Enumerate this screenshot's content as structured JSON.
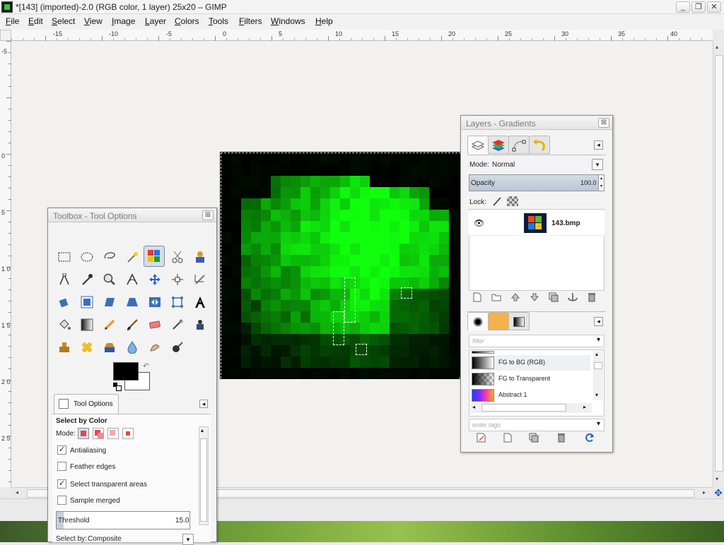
{
  "window": {
    "title": "*[143] (imported)-2.0 (RGB color, 1 layer) 25x20 – GIMP",
    "minimize": "_",
    "maximize": "❐",
    "close": "✕"
  },
  "menu": [
    "File",
    "Edit",
    "Select",
    "View",
    "Image",
    "Layer",
    "Colors",
    "Tools",
    "Filters",
    "Windows",
    "Help"
  ],
  "hruler": [
    "-15",
    "-10",
    "-5",
    "0",
    "5",
    "10",
    "15",
    "20",
    "25",
    "30",
    "35",
    "40"
  ],
  "vruler": [
    "-5",
    "0",
    "5",
    "1 0",
    "1 5",
    "2 0",
    "2 5"
  ],
  "toolbox": {
    "title": "Toolbox - Tool Options",
    "close": "⊠",
    "tools": [
      "rect-select",
      "ellipse-select",
      "free-select",
      "fuzzy-select",
      "select-by-color",
      "scissors-select",
      "foreground-select",
      "paths",
      "color-picker",
      "zoom",
      "measure",
      "move",
      "align",
      "crop",
      "rotate",
      "scale",
      "shear",
      "perspective",
      "flip",
      "cage",
      "text",
      "bucket-fill",
      "blend",
      "pencil",
      "paintbrush",
      "eraser",
      "airbrush",
      "ink",
      "clone",
      "heal",
      "perspective-clone",
      "blur",
      "smudge",
      "dodge-burn"
    ],
    "tool_options_tab": "Tool Options",
    "tool_name": "Select by Color",
    "mode_label": "Mode:",
    "antialiasing": "Antialiasing",
    "feather": "Feather edges",
    "select_transparent": "Select transparent areas",
    "sample_merged": "Sample merged",
    "threshold_label": "Threshold",
    "threshold_value": "15.0",
    "select_by_label": "Select by:",
    "select_by_value": "Composite",
    "check": "✓"
  },
  "layers": {
    "title": "Layers - Gradients",
    "close": "⊠",
    "mode_label": "Mode:",
    "mode_value": "Normal",
    "opacity_label": "Opacity",
    "opacity_value": "100.0",
    "lock_label": "Lock:",
    "layer_name": "143.bmp",
    "filter_placeholder": "filter",
    "tags_placeholder": "enter tags",
    "gradients": [
      {
        "name": "FG to BG (RGB)",
        "colors": "linear-gradient(90deg, #000, #fff)"
      },
      {
        "name": "FG to Transparent",
        "colors": "linear-gradient(90deg, #000, rgba(0,0,0,0)), repeating-conic-gradient(#bbb 0 25%, #fff 0 50%) 0 0/8px 8px"
      },
      {
        "name": "Abstract 1",
        "colors": "linear-gradient(90deg, #1f3cff, #7a2cff, #ff3ca0, #ffb01f)"
      }
    ]
  },
  "glyphs": {
    "arrow_left": "◂",
    "arrow_right": "▸",
    "arrow_up": "▴",
    "arrow_down": "▾",
    "eye": "👁",
    "nav": "✥",
    "panel_menu": "◂",
    "swap": "↶"
  }
}
